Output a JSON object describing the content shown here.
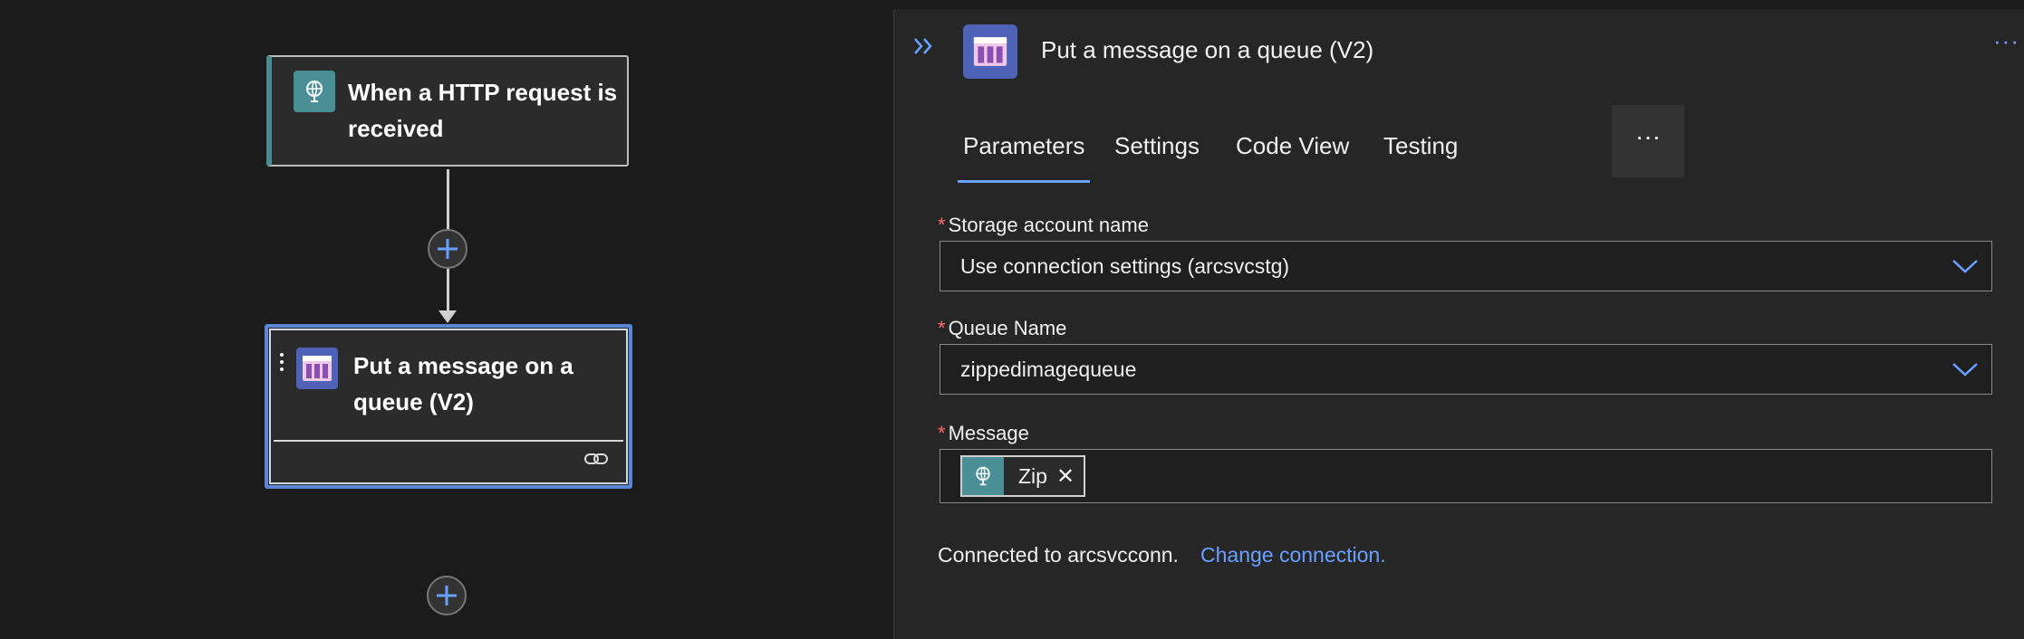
{
  "canvas": {
    "trigger": {
      "title": "When a HTTP request is received",
      "icon": "http-request-icon"
    },
    "action": {
      "title": "Put a message on a queue (V2)",
      "icon": "storage-queue-icon",
      "footer_icon": "link-icon"
    },
    "add_step_icon": "plus-icon"
  },
  "panel": {
    "collapse_icon": "double-chevron-right-icon",
    "title": "Put a message on a queue (V2)",
    "more_icon": "ellipsis-icon",
    "tabs": [
      {
        "label": "Parameters",
        "active": true
      },
      {
        "label": "Settings"
      },
      {
        "label": "Code View"
      },
      {
        "label": "Testing"
      }
    ],
    "tabs_more": "···",
    "fields": {
      "storage_account": {
        "required": "*",
        "label": "Storage account name",
        "value": "Use connection settings (arcsvcstg)"
      },
      "queue_name": {
        "required": "*",
        "label": "Queue Name",
        "value": "zippedimagequeue"
      },
      "message": {
        "required": "*",
        "label": "Message",
        "token": {
          "label": "Zip",
          "close": "✕"
        }
      }
    },
    "connection_text": "Connected to arcsvcconn.",
    "change_connection": "Change connection."
  },
  "colors": {
    "accent": "#6aa0ff",
    "trigger": "#4a8f96",
    "queue": "#4e63b8",
    "required": "#ff6a6a"
  }
}
